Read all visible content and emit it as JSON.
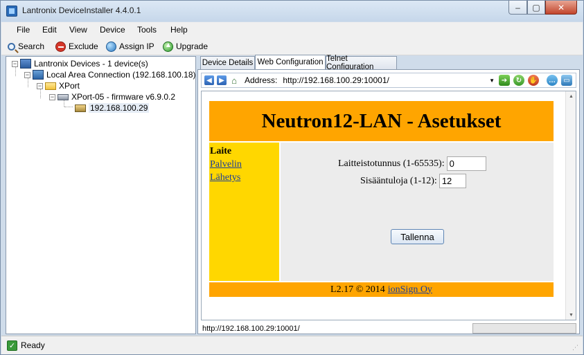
{
  "window": {
    "title": "Lantronix DeviceInstaller 4.4.0.1"
  },
  "menu": [
    "File",
    "Edit",
    "View",
    "Device",
    "Tools",
    "Help"
  ],
  "toolbar": {
    "search": "Search",
    "exclude": "Exclude",
    "assign_ip": "Assign IP",
    "upgrade": "Upgrade"
  },
  "tree": {
    "root": "Lantronix Devices - 1 device(s)",
    "lan": "Local Area Connection (192.168.100.18)",
    "folder": "XPort",
    "model": "XPort-05 - firmware v6.9.0.2",
    "device": "192.168.100.29"
  },
  "tabs": [
    "Device Details",
    "Web Configuration",
    "Telnet Configuration"
  ],
  "address": {
    "label": "Address:",
    "url": "http://192.168.100.29:10001/"
  },
  "webpage": {
    "header": "Neutron12-LAN - Asetukset",
    "nav_current": "Laite",
    "nav_links": [
      "Palvelin",
      "Lähetys"
    ],
    "field1_label": "Laitteistotunnus (1-65535):",
    "field1_value": "0",
    "field2_label": "Sisääntuloja (1-12):",
    "field2_value": "12",
    "save_button": "Tallenna",
    "footer_text": "L2.17 © 2014",
    "footer_link": "ionSign Oy"
  },
  "browser_status": {
    "url": "http://192.168.100.29:10001/"
  },
  "status": {
    "text": "Ready"
  }
}
